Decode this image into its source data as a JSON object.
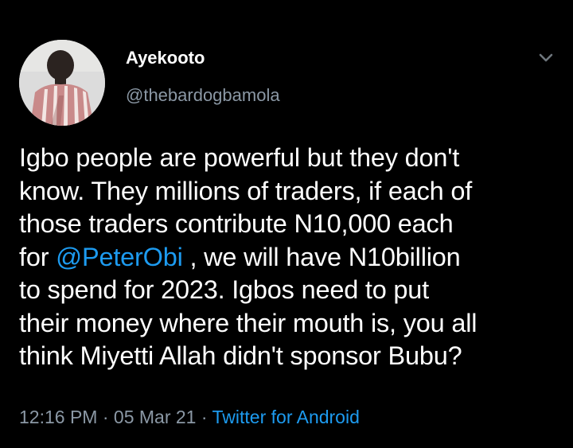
{
  "tweet": {
    "author": {
      "display_name": "Ayekooto",
      "handle": "@thebardogbamola"
    },
    "menu_icon": "chevron-down-icon",
    "text": {
      "line1": "Igbo people are powerful but they don't",
      "line2": "know. They millions of traders, if each of",
      "line3": "those traders contribute N10,000 each",
      "line4_before": "for ",
      "mention": "@PeterObi",
      "line4_after": " , we will have N10billion",
      "line5": "to spend for 2023. Igbos need to put",
      "line6": "their money where their mouth is, you all",
      "line7": "think Miyetti Allah didn't sponsor Bubu?"
    },
    "time": "12:16 PM",
    "separator": "·",
    "date": "05 Mar 21",
    "source": "Twitter for Android"
  },
  "colors": {
    "background": "#000000",
    "text": "#ffffff",
    "secondary": "#8b98a5",
    "accent": "#1d9bf0"
  }
}
